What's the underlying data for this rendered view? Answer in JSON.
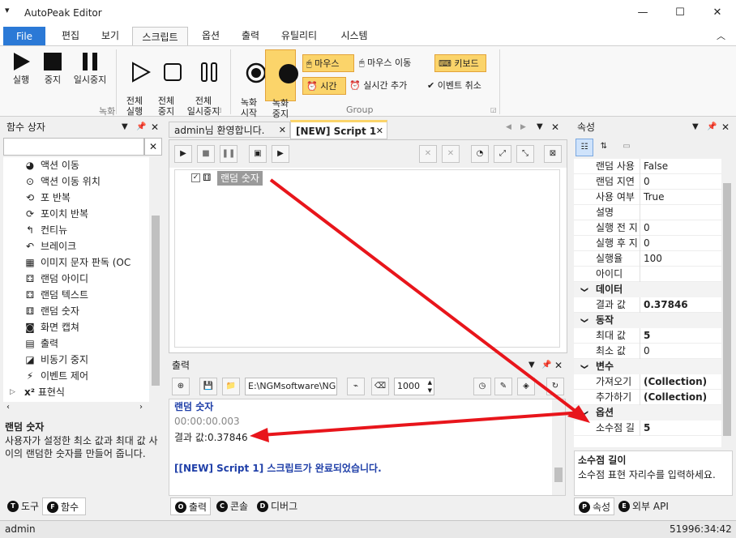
{
  "window": {
    "title": "AutoPeak Editor",
    "minimize": "—",
    "maximize": "☐",
    "close": "✕",
    "sys_menu": "▾"
  },
  "ribbon_tabs": [
    "File",
    "편집",
    "보기",
    "스크립트",
    "옵션",
    "출력",
    "유틸리티",
    "시스템"
  ],
  "ribbon": {
    "record_group": {
      "label": "녹화",
      "buttons": [
        "실행",
        "중지",
        "일시중지",
        "전체\n실행",
        "전체\n중지",
        "전체\n일시중지"
      ]
    },
    "group": {
      "label": "Group",
      "big_buttons": [
        "녹화\n시작",
        "녹화\n중지"
      ],
      "small": [
        "마우스",
        "마우스 이동",
        "키보드",
        "시간",
        "실시간 추가",
        "이벤트 취소"
      ]
    }
  },
  "function_panel": {
    "title": "함수 상자",
    "items": [
      "액션 이동",
      "액션 이동 위치",
      "포 반복",
      "포이치 반복",
      "컨티뉴",
      "브레이크",
      "이미지 문자 판독 (OC",
      "랜덤 아이디",
      "랜덤 텍스트",
      "랜덤 숫자",
      "화면 캡쳐",
      "출력",
      "비동기 중지",
      "이벤트 제어"
    ],
    "category": "표현식",
    "desc_title": "랜덤 숫자",
    "desc_text": "사용자가 설정한 최소 값과 최대 값 사이의 랜덤한 숫자를 만들어 줍니다.",
    "tabs": [
      "도구",
      "함수"
    ]
  },
  "editor": {
    "tabs": [
      "admin님 환영합니다.",
      "[NEW] Script 1"
    ],
    "node_label": "랜덤 숫자"
  },
  "output_panel": {
    "title": "출력",
    "path": "E:\\NGMsoftware\\NG",
    "count": "1000",
    "lines": [
      "랜덤 숫자",
      "00:00:00.003",
      "결과 값:0.37846",
      "[[NEW] Script 1] 스크립트가 완료되었습니다."
    ],
    "tabs": [
      "출력",
      "콘솔",
      "디버그"
    ]
  },
  "properties": {
    "title": "속성",
    "rows": [
      {
        "k": "랜덤 사용",
        "v": "False"
      },
      {
        "k": "랜덤 지연",
        "v": "0"
      },
      {
        "k": "사용 여부",
        "v": "True"
      },
      {
        "k": "설명",
        "v": ""
      },
      {
        "k": "실행 전 지",
        "v": "0"
      },
      {
        "k": "실행 후 지",
        "v": "0"
      },
      {
        "k": "실행율",
        "v": "100"
      },
      {
        "k": "아이디",
        "v": ""
      }
    ],
    "cat_data": "데이터",
    "data_rows": [
      {
        "k": "결과 값",
        "v": "0.37846"
      }
    ],
    "cat_action": "동작",
    "action_rows": [
      {
        "k": "최대 값",
        "v": "5"
      },
      {
        "k": "최소 값",
        "v": "0"
      }
    ],
    "cat_var": "변수",
    "var_rows": [
      {
        "k": "가져오기",
        "v": "(Collection)"
      },
      {
        "k": "추가하기",
        "v": "(Collection)"
      }
    ],
    "cat_option": "옵션",
    "option_rows": [
      {
        "k": "소수점 길",
        "v": "5"
      }
    ],
    "desc_title": "소수점 길이",
    "desc_text": "소수점 표현 자리수를 입력하세요.",
    "tabs": [
      "속성",
      "외부 API"
    ]
  },
  "status": {
    "user": "admin",
    "time": "51996:34:42"
  },
  "colors": {
    "accent": "#2b79d6",
    "highlight": "#fbd46a",
    "arrow": "#e8151b",
    "output_blue": "#1f3fa8"
  }
}
